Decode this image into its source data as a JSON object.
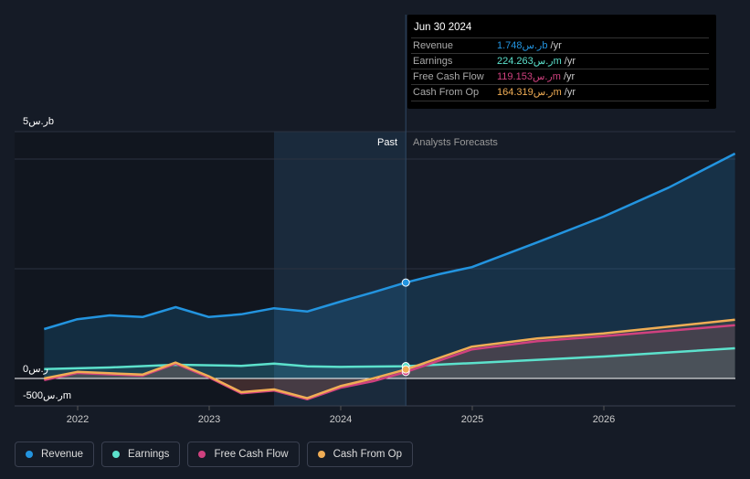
{
  "tooltip": {
    "date": "Jun 30 2024",
    "rows": [
      {
        "label": "Revenue",
        "value": "1.748ر.سb",
        "unit": " /yr",
        "color": "#2394df"
      },
      {
        "label": "Earnings",
        "value": "224.263ر.سm",
        "unit": " /yr",
        "color": "#5ce1cc"
      },
      {
        "label": "Free Cash Flow",
        "value": "119.153ر.سm",
        "unit": " /yr",
        "color": "#d0417f"
      },
      {
        "label": "Cash From Op",
        "value": "164.319ر.سm",
        "unit": " /yr",
        "color": "#f0ad55"
      }
    ]
  },
  "chart_data": {
    "type": "line",
    "y_tick_labels": [
      "5ر.سb",
      "0ر.س",
      "-500ر.سm"
    ],
    "ylim": [
      -0.5,
      4.5
    ],
    "y_unit": "ر.سb",
    "x_tick_labels": [
      "2022",
      "2023",
      "2024",
      "2025",
      "2026"
    ],
    "region_labels": {
      "past": "Past",
      "forecast": "Analysts Forecasts"
    },
    "divider_date": "2024-06-30",
    "series": [
      {
        "name": "Revenue",
        "color": "#2394df",
        "points": [
          [
            "2021-09-30",
            0.9
          ],
          [
            "2021-12-31",
            1.08
          ],
          [
            "2022-03-31",
            1.15
          ],
          [
            "2022-06-30",
            1.12
          ],
          [
            "2022-09-30",
            1.3
          ],
          [
            "2022-12-31",
            1.12
          ],
          [
            "2023-03-31",
            1.17
          ],
          [
            "2023-06-30",
            1.28
          ],
          [
            "2023-09-30",
            1.22
          ],
          [
            "2023-12-31",
            1.4
          ],
          [
            "2024-03-31",
            1.57
          ],
          [
            "2024-06-30",
            1.748
          ],
          [
            "2024-09-30",
            1.9
          ],
          [
            "2024-12-31",
            2.03
          ],
          [
            "2025-06-30",
            2.48
          ],
          [
            "2025-12-31",
            2.95
          ],
          [
            "2026-06-30",
            3.48
          ],
          [
            "2026-12-31",
            4.1
          ]
        ]
      },
      {
        "name": "Earnings",
        "color": "#5ce1cc",
        "points": [
          [
            "2021-09-30",
            0.17
          ],
          [
            "2022-03-31",
            0.2
          ],
          [
            "2022-09-30",
            0.25
          ],
          [
            "2023-03-31",
            0.23
          ],
          [
            "2023-06-30",
            0.27
          ],
          [
            "2023-09-30",
            0.22
          ],
          [
            "2023-12-31",
            0.21
          ],
          [
            "2024-06-30",
            0.224
          ],
          [
            "2024-12-31",
            0.28
          ],
          [
            "2025-12-31",
            0.4
          ],
          [
            "2026-12-31",
            0.55
          ]
        ]
      },
      {
        "name": "Free Cash Flow",
        "color": "#d0417f",
        "points": [
          [
            "2021-09-30",
            -0.03
          ],
          [
            "2021-12-31",
            0.1
          ],
          [
            "2022-06-30",
            0.05
          ],
          [
            "2022-09-30",
            0.27
          ],
          [
            "2022-12-31",
            0.02
          ],
          [
            "2023-03-31",
            -0.27
          ],
          [
            "2023-06-30",
            -0.22
          ],
          [
            "2023-09-30",
            -0.38
          ],
          [
            "2023-12-31",
            -0.17
          ],
          [
            "2024-03-31",
            -0.05
          ],
          [
            "2024-06-30",
            0.119
          ],
          [
            "2024-12-31",
            0.53
          ],
          [
            "2025-06-30",
            0.68
          ],
          [
            "2025-12-31",
            0.77
          ],
          [
            "2026-12-31",
            0.97
          ]
        ]
      },
      {
        "name": "Cash From Op",
        "color": "#f0ad55",
        "points": [
          [
            "2021-09-30",
            0.0
          ],
          [
            "2021-12-31",
            0.12
          ],
          [
            "2022-06-30",
            0.07
          ],
          [
            "2022-09-30",
            0.29
          ],
          [
            "2022-12-31",
            0.04
          ],
          [
            "2023-03-31",
            -0.25
          ],
          [
            "2023-06-30",
            -0.2
          ],
          [
            "2023-09-30",
            -0.36
          ],
          [
            "2023-12-31",
            -0.14
          ],
          [
            "2024-03-31",
            0.0
          ],
          [
            "2024-06-30",
            0.164
          ],
          [
            "2024-12-31",
            0.58
          ],
          [
            "2025-06-30",
            0.73
          ],
          [
            "2025-12-31",
            0.82
          ],
          [
            "2026-12-31",
            1.07
          ]
        ]
      }
    ]
  }
}
